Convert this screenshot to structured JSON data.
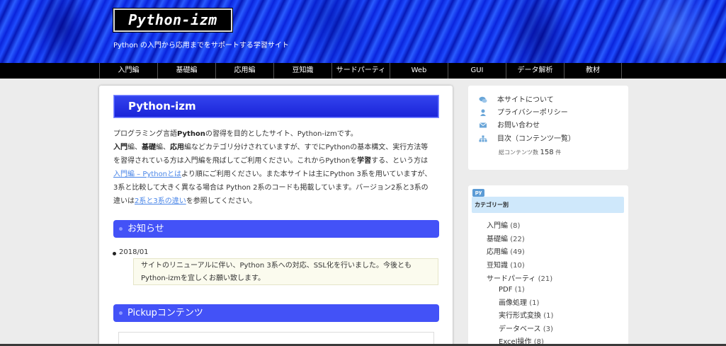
{
  "site": {
    "logo_text": "Python-izm",
    "tagline": "Python の入門から応用までをサポートする学習サイト"
  },
  "nav": [
    "入門編",
    "基礎編",
    "応用編",
    "豆知識",
    "サードパーティ",
    "Web",
    "GUI",
    "データ解析",
    "教材"
  ],
  "main": {
    "title": "Python-izm",
    "intro": {
      "p1a": "プログラミング言語",
      "p1b": "Python",
      "p1c": "の習得を目的としたサイト、Python-izmです。",
      "p2a": "入門",
      "p2b": "編、",
      "p2c": "基礎",
      "p2d": "編、",
      "p2e": "応用",
      "p2f": "編などカテゴリ分けされていますが、すでにPythonの基本構文、実行方法等",
      "p3": "を習得されている方は入門編を飛ばしてご利用ください。これからPythonを",
      "p3b": "学習",
      "p3c": "する、という方は",
      "link1": "入門編 – Pythonとは",
      "p4": "より順にご利用ください。また本サイトは主にPython 3系を用いていますが、",
      "p5": "3系と比較して大きく異なる場合は Python 2系のコードも掲載しています。バージョン2系と3系の",
      "p6a": "違いは",
      "link2": "2系と3系の違い",
      "p6b": "を参照してください。"
    },
    "news_heading": "お知らせ",
    "news_date": "2018/01",
    "news_text": "サイトのリニューアルに伴い、Python 3系への対応、SSL化を行いました。今後とも Python-izmを宜しくお願い致します。",
    "pickup_heading": "Pickupコンテンツ"
  },
  "sidebar": {
    "links": [
      {
        "label": "本サイトについて",
        "icon": "comments-icon"
      },
      {
        "label": "プライバシーポリシー",
        "icon": "user-icon"
      },
      {
        "label": "お問い合わせ",
        "icon": "envelope-icon"
      },
      {
        "label": "目次（コンテンツ一覧）",
        "icon": "sitemap-icon"
      }
    ],
    "count_label": "総コンテンツ数",
    "count_value": "158",
    "count_unit": "件",
    "badge": "py",
    "category_heading": "カテゴリー別",
    "categories": [
      {
        "label": "入門編",
        "count": "(8)"
      },
      {
        "label": "基礎編",
        "count": "(22)"
      },
      {
        "label": "応用編",
        "count": "(49)"
      },
      {
        "label": "豆知識",
        "count": "(10)"
      },
      {
        "label": "サードパーティ",
        "count": "(21)"
      }
    ],
    "subcategories": [
      {
        "label": "PDF",
        "count": "(1)"
      },
      {
        "label": "画像処理",
        "count": "(1)"
      },
      {
        "label": "実行形式変換",
        "count": "(1)"
      },
      {
        "label": "データベース",
        "count": "(3)"
      },
      {
        "label": "Excel操作",
        "count": "(8)"
      }
    ]
  },
  "colors": {
    "header_blue": "#1a3cf0",
    "section_blue": "#4352f7",
    "link_blue": "#4a86e8",
    "sidebar_icon": "#6aa6d8"
  }
}
